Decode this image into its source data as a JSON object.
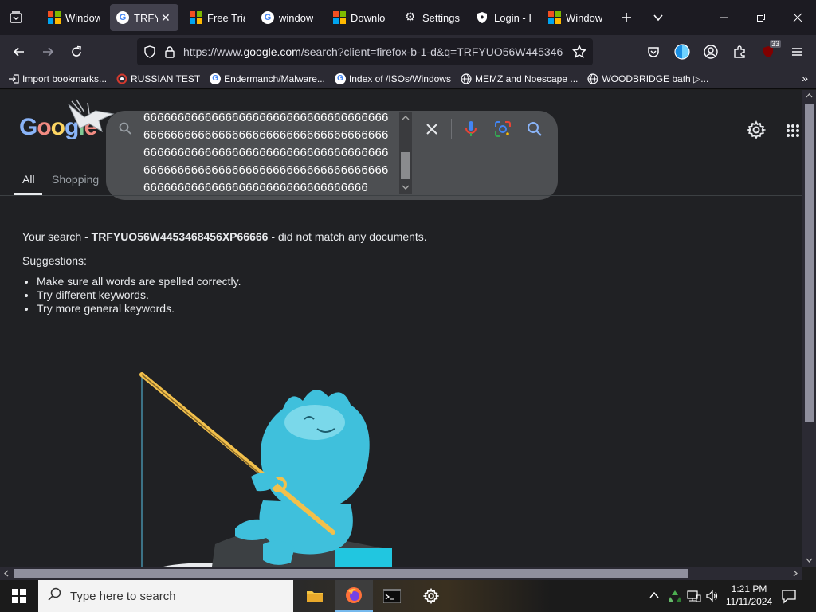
{
  "tabs": [
    {
      "label": "Window",
      "icon": "microsoft-icon",
      "active": false
    },
    {
      "label": "TRFYU",
      "icon": "google-icon",
      "active": true
    },
    {
      "label": "Free Trial",
      "icon": "microsoft-icon",
      "active": false
    },
    {
      "label": "window",
      "icon": "google-icon",
      "active": false
    },
    {
      "label": "Downlo",
      "icon": "microsoft-icon",
      "active": false
    },
    {
      "label": "Settings",
      "icon": "gear-icon",
      "active": false
    },
    {
      "label": "Login - I",
      "icon": "shield-icon",
      "active": false
    },
    {
      "label": "Window",
      "icon": "microsoft-icon",
      "active": false
    }
  ],
  "url": {
    "prefix": "https://www.",
    "host": "google.com",
    "rest": "/search?client=firefox-b-1-d&q=TRFYUO56W445346"
  },
  "extensions_badge": "33",
  "bookmarks": [
    {
      "label": "Import bookmarks...",
      "icon": "import-icon"
    },
    {
      "label": "RUSSIAN TEST",
      "icon": "search-icon"
    },
    {
      "label": "Endermanch/Malware...",
      "icon": "google-icon"
    },
    {
      "label": "Index of /ISOs/Windows",
      "icon": "google-icon"
    },
    {
      "label": "MEMZ and Noescape ...",
      "icon": "globe-icon"
    },
    {
      "label": "WOODBRIDGE bath ▷...",
      "icon": "globe-icon"
    }
  ],
  "google": {
    "logo": "Google",
    "search_text": "666666666666666666666666666666666666666666666666666666666666666666666666666666666666666666666666666666666666666666666666666666666666666666666666666666666666666666666666666666666",
    "nav_tabs": [
      "All",
      "Shopping"
    ]
  },
  "results": {
    "prefix": "Your search - ",
    "query": "TRFYUO56W4453468456XP66666",
    "suffix": " - did not match any documents.",
    "suggestions_title": "Suggestions:",
    "suggestions": [
      "Make sure all words are spelled correctly.",
      "Try different keywords.",
      "Try more general keywords."
    ]
  },
  "taskbar": {
    "search_placeholder": "Type here to search",
    "time": "1:21 PM",
    "date": "11/11/2024"
  },
  "colors": {
    "accent": "#4285f4",
    "page_bg": "#202124",
    "searchbox_bg": "#4d4f52"
  }
}
